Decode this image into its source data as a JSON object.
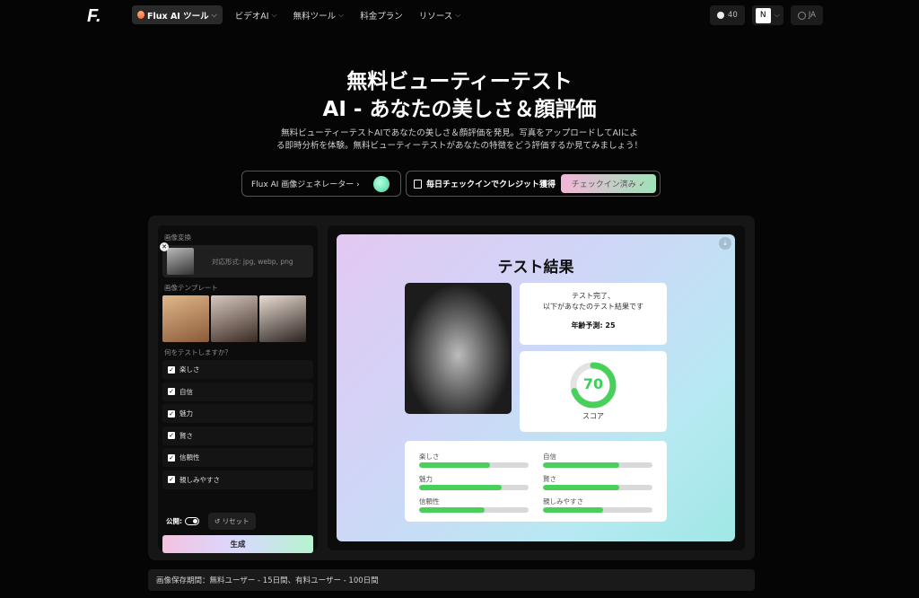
{
  "nav": {
    "logo": "F.",
    "items": [
      {
        "label": "Flux AI ツール",
        "active": true
      },
      {
        "label": "ビデオAI"
      },
      {
        "label": "無料ツール"
      },
      {
        "label": "料金プラン"
      },
      {
        "label": "リソース"
      }
    ],
    "credits": "40",
    "avatar_letter": "N",
    "language": "JA"
  },
  "hero": {
    "title_line1": "無料ビューティーテスト",
    "title_line2": "AI - あなたの美しさ＆顔評価",
    "desc_line1": "無料ビューティーテストAIであなたの美しさ＆顔評価を発見。写真をアップロードしてAIによ",
    "desc_line2": "る即時分析を体験。無料ビューティーテストがあなたの特徴をどう評価するか見てみましょう！"
  },
  "actions": {
    "generator_label": "Flux AI 画像ジェネレーター ›",
    "checkin_label": "毎日チェックインでクレジット獲得",
    "checkin_btn": "チェックイン済み ✓"
  },
  "left": {
    "upload_label": "画像変換",
    "upload_formats": "対応形式: jpg, webp, png",
    "template_label": "画像テンプレート",
    "test_label": "何をテストしますか？",
    "checks": [
      "楽しさ",
      "自信",
      "魅力",
      "賢さ",
      "信頼性",
      "親しみやすさ"
    ],
    "public_label": "公開:",
    "reset_label": "リセット",
    "generate_label": "生成"
  },
  "result": {
    "title": "テスト結果",
    "msg_line1": "テスト完了、",
    "msg_line2": "以下があなたのテスト結果です",
    "age": "年齢予測: 25",
    "score": "70",
    "score_label": "スコア",
    "bars": [
      {
        "label": "楽しさ",
        "value": 0.65
      },
      {
        "label": "自信",
        "value": 0.7
      },
      {
        "label": "魅力",
        "value": 0.75
      },
      {
        "label": "賢さ",
        "value": 0.7
      },
      {
        "label": "信頼性",
        "value": 0.6
      },
      {
        "label": "親しみやすさ",
        "value": 0.55
      }
    ]
  },
  "footer": {
    "note": "画像保存期間：無料ユーザー - 15日間、有料ユーザー - 100日間"
  },
  "colors": {
    "accent_green": "#49d05a",
    "background": "#050505"
  }
}
